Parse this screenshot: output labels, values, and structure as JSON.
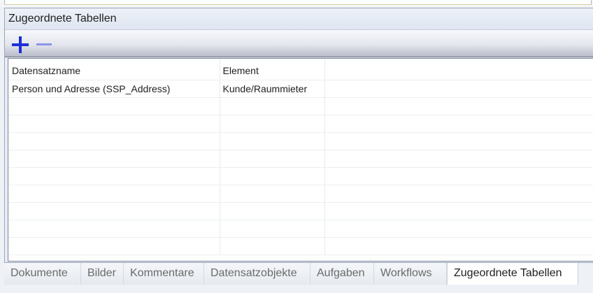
{
  "panel": {
    "title": "Zugeordnete Tabellen"
  },
  "toolbar": {
    "add_icon": "plus-icon",
    "remove_icon": "minus-icon",
    "add_color": "#1c2fd6",
    "remove_color": "#8b95e8"
  },
  "grid": {
    "columns": [
      "Datensatzname",
      "Element"
    ],
    "rows": [
      [
        "Person und Adresse (SSP_Address)",
        "Kunde/Raummieter"
      ]
    ]
  },
  "tabs": [
    {
      "label": "Dokumente",
      "active": false
    },
    {
      "label": "Bilder",
      "active": false
    },
    {
      "label": "Kommentare",
      "active": false
    },
    {
      "label": "Datensatzobjekte",
      "active": false
    },
    {
      "label": "Aufgaben",
      "active": false
    },
    {
      "label": "Workflows",
      "active": false
    },
    {
      "label": "Zugeordnete Tabellen",
      "active": true
    }
  ]
}
